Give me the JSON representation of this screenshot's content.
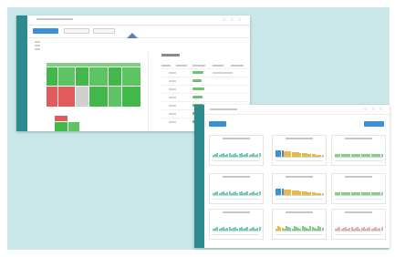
{
  "screens": [
    {
      "type": "dashboard-table-view"
    },
    {
      "type": "dashboard-cards-view",
      "cards": [
        {
          "chart": "line",
          "colors": [
            "#7cc9b8"
          ]
        },
        {
          "chart": "area",
          "colors": [
            "#3f8fd6",
            "#e8b94a"
          ]
        },
        {
          "chart": "bars",
          "colors": [
            "#8cc98c"
          ]
        },
        {
          "chart": "line",
          "colors": [
            "#7cc9b8"
          ]
        },
        {
          "chart": "area",
          "colors": [
            "#3f8fd6",
            "#e8b94a"
          ]
        },
        {
          "chart": "bars",
          "colors": [
            "#8cc98c"
          ]
        },
        {
          "chart": "line",
          "colors": [
            "#7cc9b8"
          ]
        },
        {
          "chart": "mixed",
          "colors": [
            "#e8b94a",
            "#8cc98c"
          ]
        },
        {
          "chart": "line",
          "colors": [
            "#e6b0b0"
          ]
        }
      ]
    }
  ],
  "colors": {
    "background": "#c9e6e8",
    "rail": "#2d8a8f",
    "accent": "#3b8fd9",
    "status_green": "#43b84a",
    "status_red": "#e35a5a"
  }
}
